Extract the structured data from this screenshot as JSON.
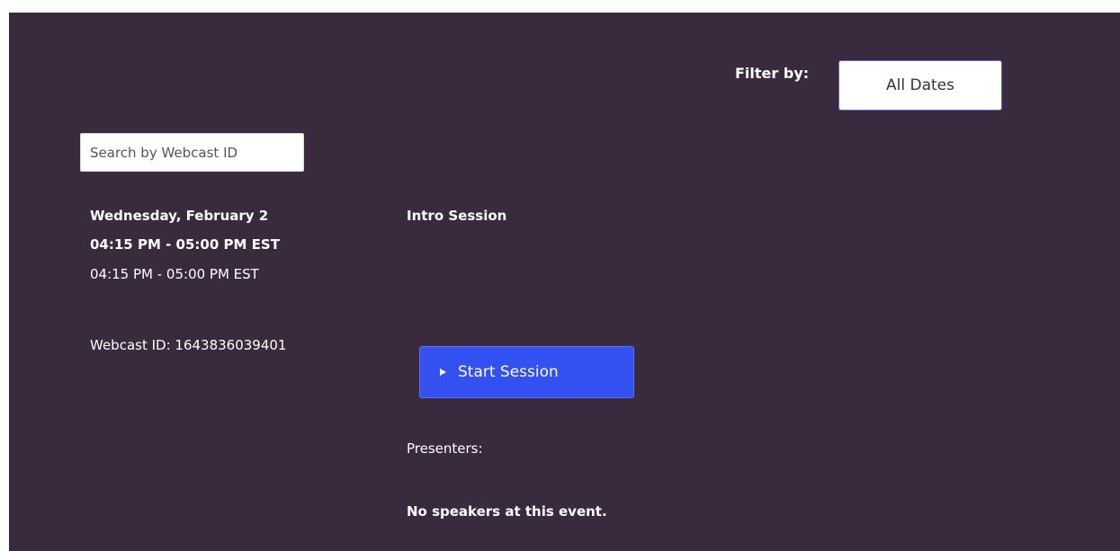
{
  "filter": {
    "label": "Filter by:",
    "selected": "All Dates"
  },
  "search": {
    "placeholder": "Search by Webcast ID",
    "value": ""
  },
  "session": {
    "date": "Wednesday, February 2",
    "time_primary": "04:15 PM - 05:00 PM EST",
    "time_secondary": "04:15 PM - 05:00 PM EST",
    "webcast_id": "Webcast ID: 1643836039401",
    "title": "Intro Session",
    "start_label": "Start Session",
    "presenters_label": "Presenters:",
    "no_speakers": "No speakers at this event."
  },
  "colors": {
    "background": "#3a2a3e",
    "accent_button": "#3350f0"
  },
  "icons": {
    "start": "play-icon"
  }
}
